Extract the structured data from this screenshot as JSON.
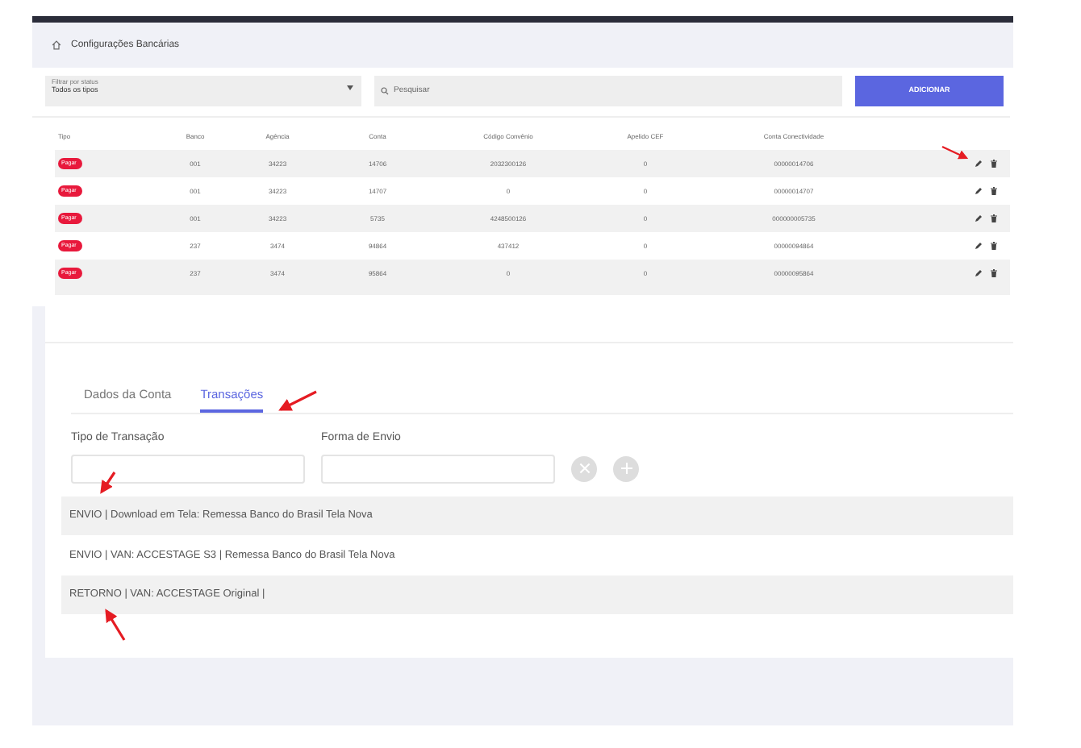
{
  "header": {
    "title": "Configurações Bancárias"
  },
  "filter": {
    "label": "Filtrar por status",
    "value": "Todos os tipos"
  },
  "search": {
    "placeholder": "Pesquisar"
  },
  "add_button": "ADICIONAR",
  "table": {
    "columns": [
      "Tipo",
      "Banco",
      "Agência",
      "Conta",
      "Código Convênio",
      "Apelido CEF",
      "Conta Conectividade"
    ],
    "rows": [
      {
        "cells": [
          "Pagar",
          "001",
          "34223",
          "14706",
          "2032300126",
          "0",
          "00000014706"
        ]
      },
      {
        "cells": [
          "Pagar",
          "001",
          "34223",
          "14707",
          "0",
          "0",
          "00000014707"
        ]
      },
      {
        "cells": [
          "Pagar",
          "001",
          "34223",
          "5735",
          "4248500126",
          "0",
          "000000005735"
        ]
      },
      {
        "cells": [
          "Pagar",
          "237",
          "3474",
          "94864",
          "437412",
          "0",
          "00000094864"
        ]
      },
      {
        "cells": [
          "Pagar",
          "237",
          "3474",
          "95864",
          "0",
          "0",
          "00000095864"
        ]
      }
    ]
  },
  "tabs": [
    {
      "label": "Dados da Conta",
      "selected": false
    },
    {
      "label": "Transações",
      "selected": true
    }
  ],
  "fields": [
    {
      "label": "Tipo de Transação"
    },
    {
      "label": "Forma de Envio"
    }
  ],
  "transactions": [
    {
      "text": "ENVIO | Download em Tela: Remessa Banco do Brasil Tela Nova"
    },
    {
      "text": "ENVIO | VAN: ACCESTAGE S3 | Remessa Banco do Brasil Tela Nova"
    },
    {
      "text": "RETORNO | VAN: ACCESTAGE Original |"
    }
  ]
}
